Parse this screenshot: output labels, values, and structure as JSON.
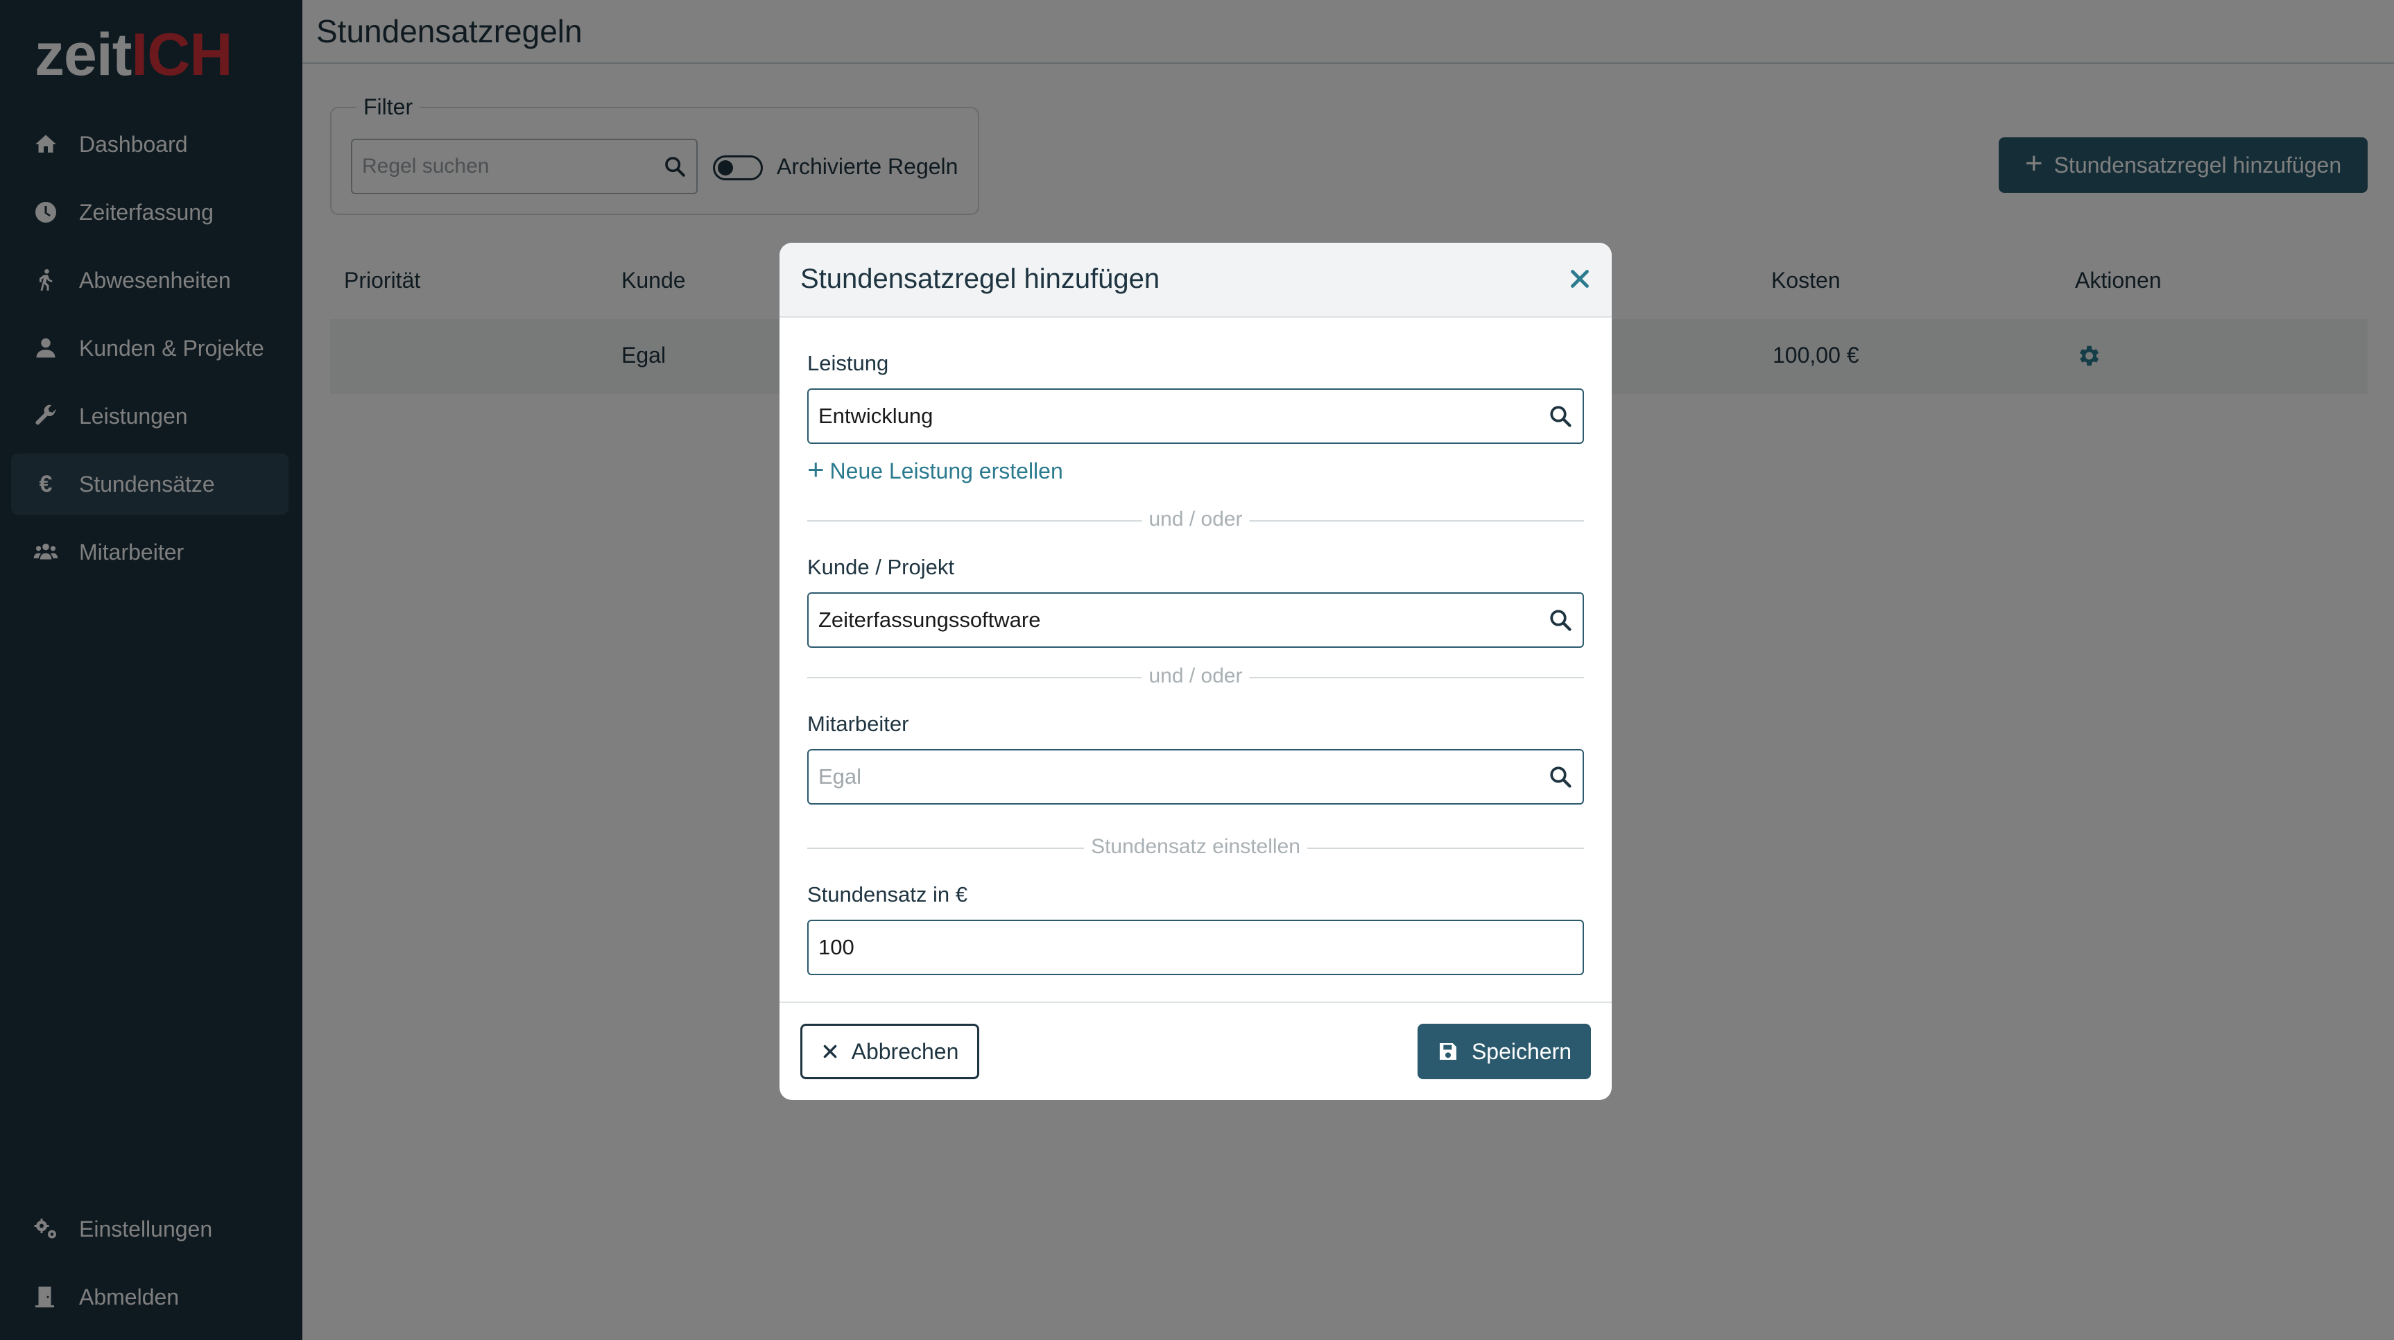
{
  "sidebar": {
    "logo": {
      "part1": "zeit",
      "part2": "ICH"
    },
    "items": [
      {
        "label": "Dashboard",
        "icon": "home-icon"
      },
      {
        "label": "Zeiterfassung",
        "icon": "clock-icon"
      },
      {
        "label": "Abwesenheiten",
        "icon": "walking-icon"
      },
      {
        "label": "Kunden & Projekte",
        "icon": "user-icon"
      },
      {
        "label": "Leistungen",
        "icon": "wrench-icon"
      },
      {
        "label": "Stundensätze",
        "icon": "euro-icon",
        "active": true
      },
      {
        "label": "Mitarbeiter",
        "icon": "users-icon"
      }
    ],
    "bottom_items": [
      {
        "label": "Einstellungen",
        "icon": "gears-icon"
      },
      {
        "label": "Abmelden",
        "icon": "door-icon"
      }
    ]
  },
  "header": {
    "title": "Stundensatzregeln"
  },
  "filter": {
    "legend": "Filter",
    "search_placeholder": "Regel suchen",
    "toggle_label": "Archivierte Regeln",
    "toggle_on": false
  },
  "add_button": {
    "label": "Stundensatzregel hinzufügen"
  },
  "table": {
    "columns": {
      "priority": "Priorität",
      "customer": "Kunde",
      "cost": "Kosten",
      "actions": "Aktionen"
    },
    "rows": [
      {
        "priority": "",
        "customer": "Egal",
        "cost": "100,00 €"
      }
    ]
  },
  "modal": {
    "title": "Stundensatzregel hinzufügen",
    "leistung": {
      "label": "Leistung",
      "value": "Entwicklung"
    },
    "new_leistung_link": "Neue Leistung erstellen",
    "divider1": "und / oder",
    "kunde": {
      "label": "Kunde / Projekt",
      "value": "Zeiterfassungssoftware"
    },
    "divider2": "und / oder",
    "mitarbeiter": {
      "label": "Mitarbeiter",
      "placeholder": "Egal"
    },
    "divider3": "Stundensatz einstellen",
    "stundensatz": {
      "label": "Stundensatz in €",
      "value": "100"
    },
    "cancel_label": "Abbrechen",
    "save_label": "Speichern"
  },
  "colors": {
    "sidebar_bg": "#1e3440",
    "sidebar_active": "#2e4756",
    "accent": "#2b5a6e",
    "logo_red": "#d9323c",
    "link": "#2b7a8e"
  }
}
